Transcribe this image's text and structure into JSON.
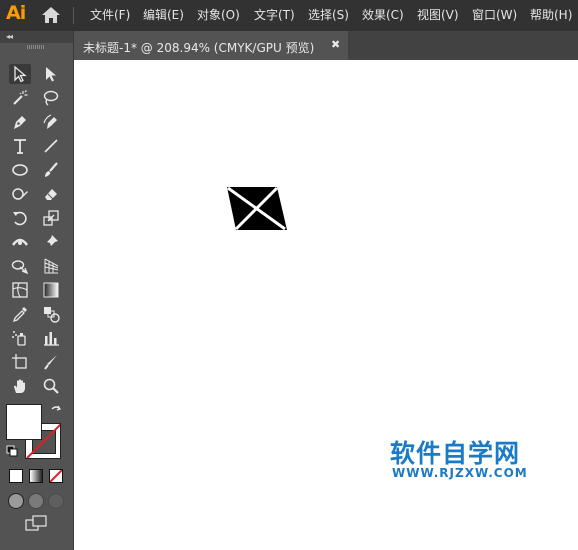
{
  "app": {
    "logo_text": "Ai"
  },
  "menu": {
    "items": [
      {
        "label": "文件(F)"
      },
      {
        "label": "编辑(E)"
      },
      {
        "label": "对象(O)"
      },
      {
        "label": "文字(T)"
      },
      {
        "label": "选择(S)"
      },
      {
        "label": "效果(C)"
      },
      {
        "label": "视图(V)"
      },
      {
        "label": "窗口(W)"
      },
      {
        "label": "帮助(H)"
      }
    ]
  },
  "document_tab": {
    "label": "未标题-1* @ 208.94% (CMYK/GPU 预览)",
    "close_glyph": "✖"
  },
  "toolbar": {
    "collapse_glyph": "◂◂",
    "tools": [
      {
        "name": "selection-tool",
        "icon": "selection-arrow-icon",
        "active": true
      },
      {
        "name": "direct-selection-tool",
        "icon": "direct-selection-arrow-icon"
      },
      {
        "name": "magic-wand-tool",
        "icon": "magic-wand-icon"
      },
      {
        "name": "lasso-tool",
        "icon": "lasso-icon"
      },
      {
        "name": "pen-tool",
        "icon": "pen-icon"
      },
      {
        "name": "curvature-tool",
        "icon": "curvature-pen-icon"
      },
      {
        "name": "type-tool",
        "icon": "type-icon"
      },
      {
        "name": "line-segment-tool",
        "icon": "line-segment-icon"
      },
      {
        "name": "ellipse-tool",
        "icon": "ellipse-icon"
      },
      {
        "name": "paintbrush-tool",
        "icon": "paintbrush-icon"
      },
      {
        "name": "shaper-tool",
        "icon": "shaper-icon"
      },
      {
        "name": "eraser-tool",
        "icon": "eraser-icon"
      },
      {
        "name": "rotate-tool",
        "icon": "rotate-icon"
      },
      {
        "name": "scale-tool",
        "icon": "scale-icon"
      },
      {
        "name": "width-tool",
        "icon": "width-icon"
      },
      {
        "name": "puppet-warp-tool",
        "icon": "pin-icon"
      },
      {
        "name": "shape-builder-tool",
        "icon": "shape-builder-icon"
      },
      {
        "name": "perspective-grid-tool",
        "icon": "perspective-grid-icon"
      },
      {
        "name": "mesh-tool",
        "icon": "mesh-icon"
      },
      {
        "name": "gradient-tool",
        "icon": "gradient-icon"
      },
      {
        "name": "eyedropper-tool",
        "icon": "eyedropper-icon"
      },
      {
        "name": "blend-tool",
        "icon": "blend-icon"
      },
      {
        "name": "symbol-sprayer-tool",
        "icon": "symbol-sprayer-icon"
      },
      {
        "name": "column-graph-tool",
        "icon": "column-graph-icon"
      },
      {
        "name": "artboard-tool",
        "icon": "artboard-icon"
      },
      {
        "name": "slice-tool",
        "icon": "slice-icon"
      },
      {
        "name": "hand-tool",
        "icon": "hand-icon"
      },
      {
        "name": "zoom-tool",
        "icon": "zoom-icon"
      }
    ],
    "fill_color": "#ffffff",
    "stroke_color": "none"
  },
  "canvas": {
    "background": "#ffffff",
    "artwork_color": "#000000"
  },
  "watermark": {
    "title": "软件自学网",
    "url": "WWW.RJZXW.COM",
    "color": "#1a7ac6"
  }
}
